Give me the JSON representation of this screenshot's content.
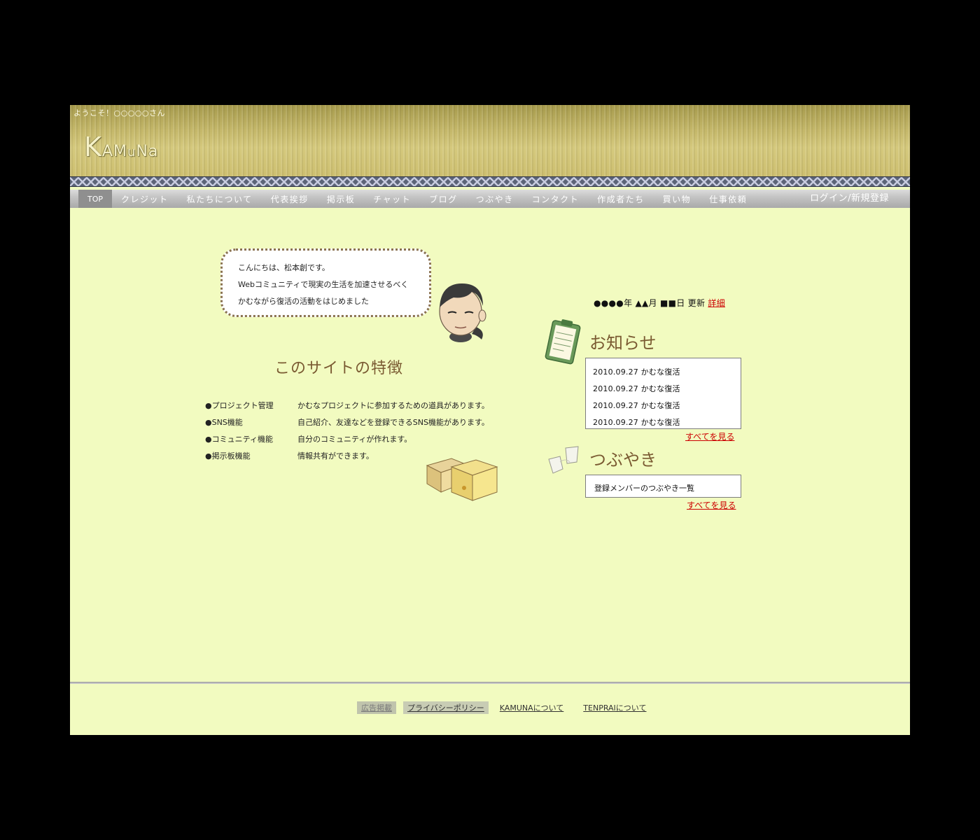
{
  "header": {
    "welcome": "ようこそ！○○○○○さん",
    "logo": {
      "k": "K",
      "a": "A",
      "m": "M",
      "u": "u",
      "n": "N",
      "a2": "a"
    }
  },
  "nav": {
    "items": [
      "TOP",
      "クレジット",
      "私たちについて",
      "代表挨拶",
      "掲示板",
      "チャット",
      "ブログ",
      "つぶやき",
      "コンタクト",
      "作成者たち",
      "買い物",
      "仕事依頼"
    ],
    "login": "ログイン/新規登録"
  },
  "greeting": {
    "lines": [
      "こんにちは、松本創です。",
      "Webコミュニティで現実の生活を加速させるべく",
      "かむながら復活の活動をはじめました"
    ]
  },
  "features": {
    "title": "このサイトの特徴",
    "rows": [
      {
        "name": "●プロジェクト管理",
        "desc": "かむなプロジェクトに参加するための道具があります。"
      },
      {
        "name": "●SNS機能",
        "desc": "自己紹介、友達などを登録できるSNS機能があります。"
      },
      {
        "name": "●コミュニティ機能",
        "desc": "自分のコミュニティが作れます。"
      },
      {
        "name": "●掲示板機能",
        "desc": "情報共有ができます。"
      }
    ]
  },
  "update": {
    "text": "●●●●年 ▲▲月 ■■日 更新 ",
    "link": "詳細"
  },
  "news": {
    "title": "お知らせ",
    "items": [
      "2010.09.27 かむな復活",
      "2010.09.27 かむな復活",
      "2010.09.27 かむな復活",
      "2010.09.27 かむな復活"
    ],
    "see_all": "すべてを見る"
  },
  "tweets": {
    "title": "つぶやき",
    "item": "登録メンバーのつぶやき一覧",
    "see_all": "すべてを見る"
  },
  "footer": {
    "links": [
      "広告掲載",
      "プライバシーポリシー",
      "KAMUNAについて",
      "TENPRAIについて"
    ]
  },
  "colors": {
    "background": "#f2fbc0",
    "heading": "#7a5a32",
    "link": "#cc0000",
    "nav": "#a9a9a9"
  }
}
